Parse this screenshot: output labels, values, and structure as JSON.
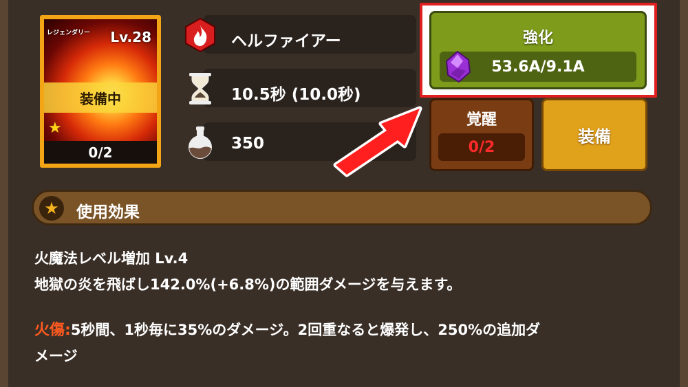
{
  "skill": {
    "rarity": "レジェンダリー",
    "level": "Lv.28",
    "equipped_label": "装備中",
    "count": "0/2",
    "name": "ヘルファイアー",
    "cooldown": "10.5秒 (10.0秒)",
    "cost": "350"
  },
  "buttons": {
    "enhance_label": "強化",
    "enhance_cost": "53.6A/9.1A",
    "awaken_label": "覚醒",
    "awaken_count": "0/2",
    "equip_label": "装備"
  },
  "effects": {
    "section_title": "使用効果",
    "line1": "火魔法レベル増加 Lv.4",
    "line2": "地獄の炎を飛ばし142.0%(+6.8%)の範囲ダメージを与えます。",
    "burn_label": "火傷:",
    "burn_text": "5秒間、1秒毎に35%のダメージ。2回重なると爆発し、250%の追加ダ",
    "burn_text2": "メージ"
  },
  "icons": {
    "fire": "fire-icon",
    "hourglass": "hourglass-icon",
    "potion": "potion-icon",
    "gem": "gem-icon",
    "star": "star-icon"
  },
  "colors": {
    "enhance": "#7e9b1b",
    "awaken": "#7a3d13",
    "equip": "#e0a11b",
    "highlight": "#e02020",
    "burn": "#ff5a1f"
  }
}
